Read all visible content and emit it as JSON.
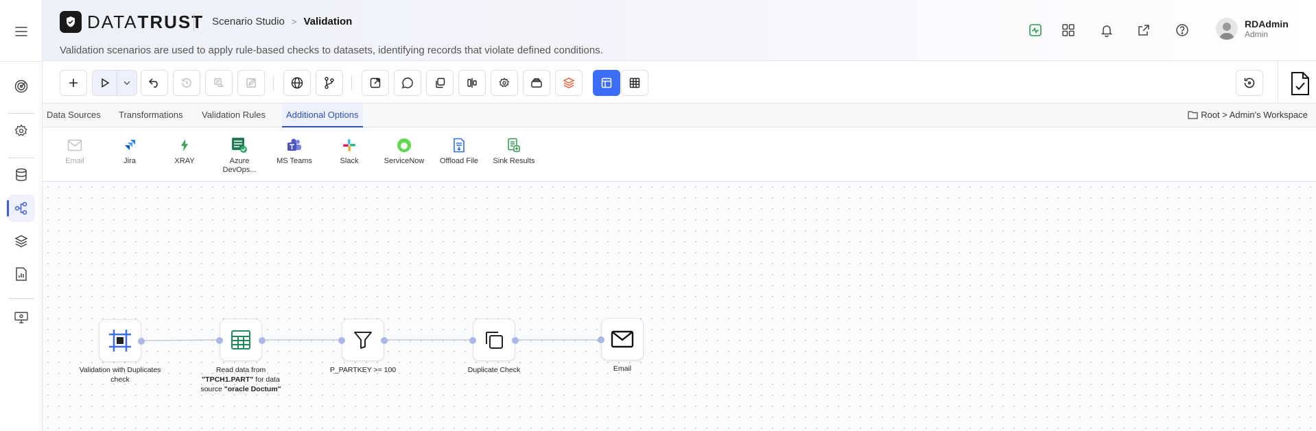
{
  "app": {
    "logo_left": "DATA",
    "logo_right": "TRUST"
  },
  "breadcrumb": {
    "parent": "Scenario Studio",
    "separator": ">",
    "current": "Validation"
  },
  "subtitle": "Validation scenarios are used to apply rule-based checks to datasets, identifying records that violate defined conditions.",
  "user": {
    "name": "RDAdmin",
    "role": "Admin"
  },
  "tabs": [
    {
      "label": "Data Sources"
    },
    {
      "label": "Transformations"
    },
    {
      "label": "Validation Rules"
    },
    {
      "label": "Additional Options"
    }
  ],
  "active_tab": "Additional Options",
  "workspace_path": "Root > Admin's Workspace",
  "options": [
    {
      "label": "Email",
      "icon": "mail-icon",
      "disabled": true
    },
    {
      "label": "Jira",
      "icon": "jira-icon"
    },
    {
      "label": "XRAY",
      "icon": "xray-icon"
    },
    {
      "label": "Azure DevOps...",
      "icon": "azure-devops-icon"
    },
    {
      "label": "MS Teams",
      "icon": "ms-teams-icon"
    },
    {
      "label": "Slack",
      "icon": "slack-icon"
    },
    {
      "label": "ServiceNow",
      "icon": "servicenow-icon"
    },
    {
      "label": "Offload File",
      "icon": "offload-file-icon"
    },
    {
      "label": "Sink Results",
      "icon": "sink-results-icon"
    }
  ],
  "nodes": [
    {
      "label": "Validation with Duplicates check",
      "icon": "scenario-frame-icon"
    },
    {
      "label_prefix": "Read data from ",
      "label_bold1": "\"TPCH1.PART\"",
      "label_mid": " for data source ",
      "label_bold2": "\"oracle Doctum\"",
      "icon": "table-icon"
    },
    {
      "label": "P_PARTKEY >= 100",
      "icon": "filter-icon"
    },
    {
      "label": "Duplicate Check",
      "icon": "copy-icon"
    },
    {
      "label": "Email",
      "icon": "mail-icon"
    }
  ],
  "colors": {
    "accent": "#3b6ef5",
    "tab_active": "#2b4fc2",
    "port": "#a9b8e8",
    "health_green": "#2e9b4f"
  }
}
